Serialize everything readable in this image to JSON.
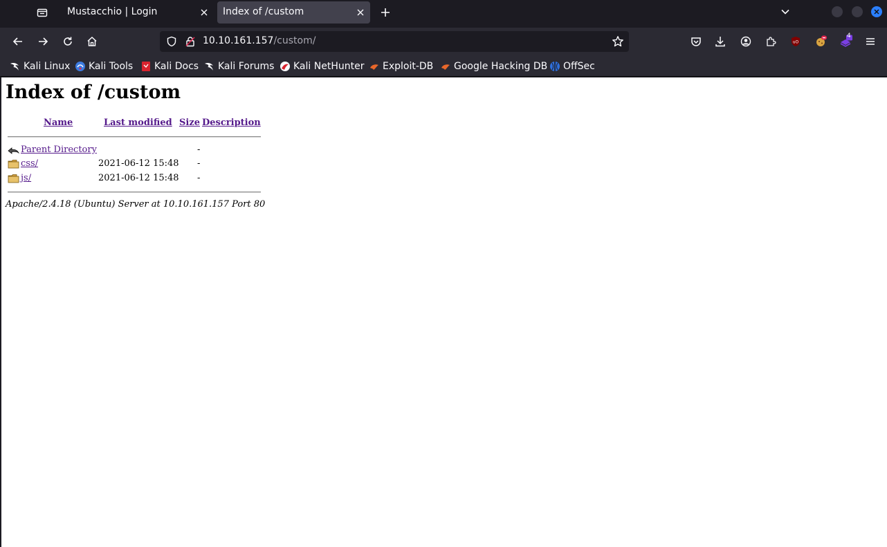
{
  "browser": {
    "tabs": [
      {
        "title": "Mustacchio | Login",
        "active": false
      },
      {
        "title": "Index of /custom",
        "active": true
      }
    ],
    "url": {
      "host": "10.10.161.157",
      "path": "/custom/"
    },
    "toolbar": {
      "extension_badge_count": "4"
    },
    "bookmarks": [
      {
        "label": "Kali Linux",
        "icon": "kali-dragon-icon"
      },
      {
        "label": "Kali Tools",
        "icon": "kali-tools-icon"
      },
      {
        "label": "Kali Docs",
        "icon": "kali-docs-icon"
      },
      {
        "label": "Kali Forums",
        "icon": "kali-dragon-icon"
      },
      {
        "label": "Kali NetHunter",
        "icon": "nethunter-icon"
      },
      {
        "label": "Exploit-DB",
        "icon": "exploit-db-icon"
      },
      {
        "label": "Google Hacking DB",
        "icon": "exploit-db-icon"
      },
      {
        "label": "OffSec",
        "icon": "offsec-icon"
      }
    ],
    "accent_color": "#2b7fff"
  },
  "page": {
    "title": "Index of /custom",
    "columns": {
      "name": "Name",
      "last_modified": "Last modified",
      "size": "Size",
      "description": "Description"
    },
    "rows": [
      {
        "name": "Parent Directory",
        "last_modified": "",
        "size": "-",
        "icon": "back-arrow-icon"
      },
      {
        "name": "css/",
        "last_modified": "2021-06-12 15:48",
        "size": "-",
        "icon": "folder-icon"
      },
      {
        "name": "js/",
        "last_modified": "2021-06-12 15:48",
        "size": "-",
        "icon": "folder-icon"
      }
    ],
    "footer": "Apache/2.4.18 (Ubuntu) Server at 10.10.161.157 Port 80",
    "link_color": "#551a8b",
    "unvisited_link_color": "#0000ee"
  }
}
